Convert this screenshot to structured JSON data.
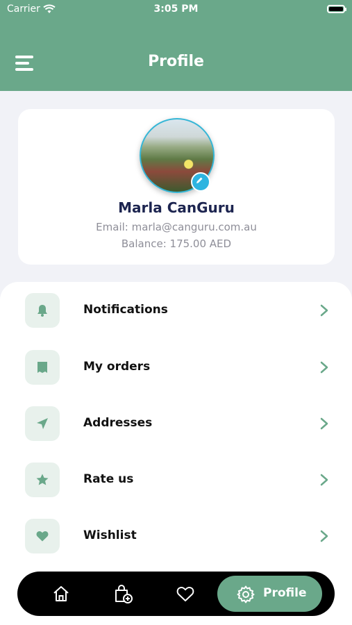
{
  "status_bar": {
    "carrier": "Carrier",
    "time": "3:05 PM"
  },
  "header": {
    "title": "Profile"
  },
  "profile": {
    "name": "Marla CanGuru",
    "email_line": "Email: marla@canguru.com.au",
    "balance_line": "Balance: 175.00 AED"
  },
  "menu": {
    "items": [
      {
        "label": "Notifications",
        "icon": "bell-icon"
      },
      {
        "label": "My orders",
        "icon": "receipt-icon"
      },
      {
        "label": "Addresses",
        "icon": "location-arrow-icon"
      },
      {
        "label": "Rate us",
        "icon": "star-icon"
      },
      {
        "label": "Wishlist",
        "icon": "heart-icon"
      }
    ]
  },
  "tabbar": {
    "items": [
      {
        "name": "home",
        "icon": "home-icon"
      },
      {
        "name": "cart",
        "icon": "shopping-bag-add-icon"
      },
      {
        "name": "wishlist",
        "icon": "heart-outline-icon"
      },
      {
        "name": "profile",
        "icon": "gear-icon",
        "label": "Profile",
        "active": true
      }
    ]
  },
  "colors": {
    "brand_green": "#6aa88a",
    "icon_bg": "#e8f1ec",
    "name_color": "#1d2550",
    "badge_blue": "#2eb4e0"
  }
}
